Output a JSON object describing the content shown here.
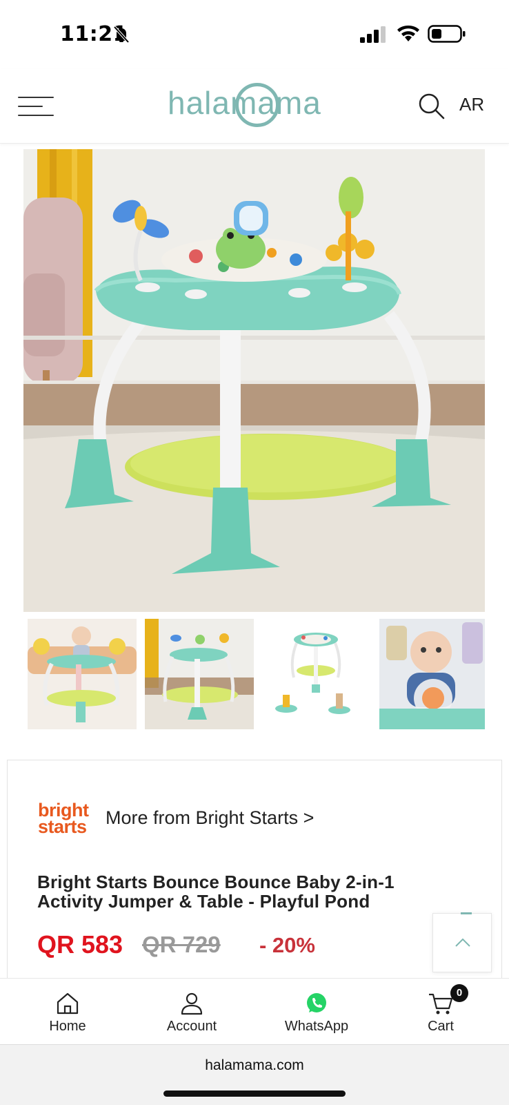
{
  "status_bar": {
    "time": "11:21",
    "icons": [
      "bell-off-icon",
      "signal-icon",
      "wifi-icon",
      "battery-icon"
    ]
  },
  "header": {
    "logo_text": "halamama",
    "language_label": "AR",
    "icons": [
      "menu-icon",
      "search-icon"
    ]
  },
  "gallery": {
    "thumbnail_count": 4
  },
  "product": {
    "brand_logo_lines": [
      "bright",
      "starts"
    ],
    "brand_link": "More from Bright Starts >",
    "title": "Bright Starts Bounce Bounce Baby 2-in-1 Activity Jumper & Table - Playful Pond",
    "price_current": "QR 583",
    "price_old": "QR 729",
    "discount": "- 20%"
  },
  "bottom_nav": {
    "items": [
      {
        "label": "Home",
        "icon": "home-icon"
      },
      {
        "label": "Account",
        "icon": "account-icon"
      },
      {
        "label": "WhatsApp",
        "icon": "whatsapp-icon"
      },
      {
        "label": "Cart",
        "icon": "cart-icon"
      }
    ],
    "cart_count": "0"
  },
  "browser": {
    "url": "halamama.com"
  },
  "colors": {
    "brand_teal": "#7fb7b2",
    "price_red": "#e0141e",
    "discount_red": "#c8323a",
    "brand_orange": "#e8591f",
    "whatsapp_green": "#25d366"
  }
}
